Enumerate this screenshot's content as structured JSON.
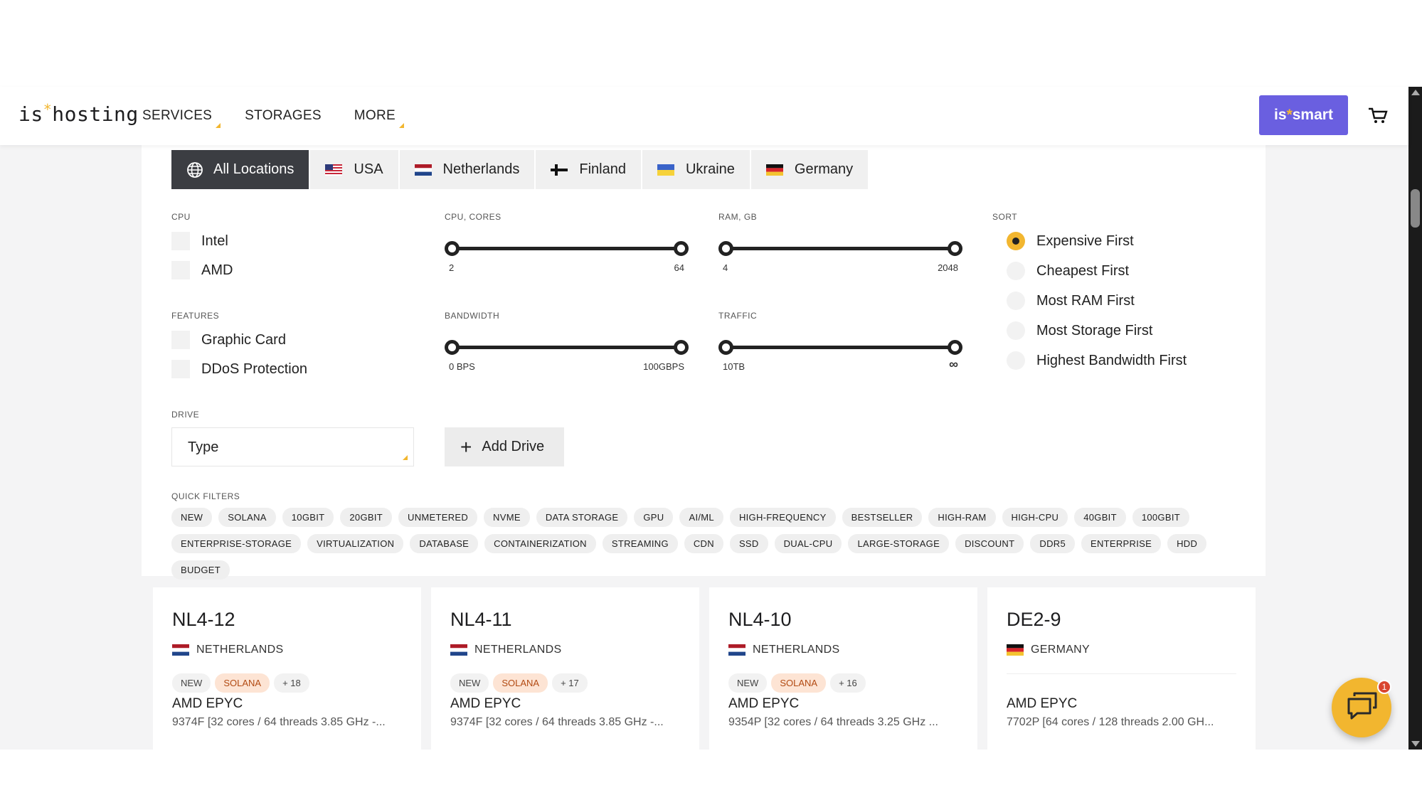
{
  "header": {
    "logo_pre": "is",
    "logo_star": "*",
    "logo_post": "hosting",
    "nav": [
      {
        "label": "SERVICES",
        "has_dropdown": true
      },
      {
        "label": "STORAGES",
        "has_dropdown": false
      },
      {
        "label": "MORE",
        "has_dropdown": true
      }
    ],
    "smart_pre": "is",
    "smart_star": "*",
    "smart_post": "smart"
  },
  "locations": [
    {
      "label": "All Locations",
      "active": true
    },
    {
      "label": "USA",
      "active": false
    },
    {
      "label": "Netherlands",
      "active": false
    },
    {
      "label": "Finland",
      "active": false
    },
    {
      "label": "Ukraine",
      "active": false
    },
    {
      "label": "Germany",
      "active": false
    }
  ],
  "filters": {
    "cpu_label": "CPU",
    "cpu_options": [
      "Intel",
      "AMD"
    ],
    "features_label": "FEATURES",
    "feature_options": [
      "Graphic Card",
      "DDoS Protection"
    ],
    "drive_label": "DRIVE",
    "drive_type": "Type",
    "add_drive": "Add Drive",
    "cpu_cores": {
      "label": "CPU, CORES",
      "min": "2",
      "max": "64"
    },
    "ram": {
      "label": "RAM, GB",
      "min": "4",
      "max": "2048"
    },
    "bandwidth": {
      "label": "BANDWIDTH",
      "min": "0 BPS",
      "max": "100GBPS"
    },
    "traffic": {
      "label": "TRAFFIC",
      "min": "10TB",
      "max": "∞"
    },
    "sort_label": "SORT",
    "sort_options": [
      {
        "label": "Expensive First",
        "selected": true
      },
      {
        "label": "Cheapest First",
        "selected": false
      },
      {
        "label": "Most RAM First",
        "selected": false
      },
      {
        "label": "Most Storage First",
        "selected": false
      },
      {
        "label": "Highest Bandwidth First",
        "selected": false
      }
    ],
    "quick_filters_label": "QUICK FILTERS",
    "quick_filters": [
      "NEW",
      "SOLANA",
      "10GBIT",
      "20GBIT",
      "UNMETERED",
      "NVME",
      "DATA STORAGE",
      "GPU",
      "AI/ML",
      "HIGH-FREQUENCY",
      "BESTSELLER",
      "HIGH-RAM",
      "HIGH-CPU",
      "40GBIT",
      "100GBIT",
      "ENTERPRISE-STORAGE",
      "VIRTUALIZATION",
      "DATABASE",
      "CONTAINERIZATION",
      "STREAMING",
      "CDN",
      "SSD",
      "DUAL-CPU",
      "LARGE-STORAGE",
      "DISCOUNT",
      "DDR5",
      "ENTERPRISE",
      "HDD",
      "BUDGET"
    ]
  },
  "cards": [
    {
      "name": "NL4-12",
      "country": "NETHERLANDS",
      "flag": "nl",
      "tags": [
        "NEW",
        "SOLANA",
        "+ 18"
      ],
      "cpu": "AMD EPYC",
      "cpu_detail": "9374F [32 cores / 64 threads 3.85 GHz -..."
    },
    {
      "name": "NL4-11",
      "country": "NETHERLANDS",
      "flag": "nl",
      "tags": [
        "NEW",
        "SOLANA",
        "+ 17"
      ],
      "cpu": "AMD EPYC",
      "cpu_detail": "9374F [32 cores / 64 threads 3.85 GHz -..."
    },
    {
      "name": "NL4-10",
      "country": "NETHERLANDS",
      "flag": "nl",
      "tags": [
        "NEW",
        "SOLANA",
        "+ 16"
      ],
      "cpu": "AMD EPYC",
      "cpu_detail": "9354P [32 cores / 64 threads 3.25 GHz ..."
    },
    {
      "name": "DE2-9",
      "country": "GERMANY",
      "flag": "de",
      "tags": [],
      "cpu": "AMD EPYC",
      "cpu_detail": "7702P [64 cores / 128 threads 2.00 GH..."
    }
  ],
  "chat": {
    "badge": "1"
  },
  "colors": {
    "accent": "#f2b62f",
    "smart": "#6a5fe0",
    "active_tab": "#3b3d42",
    "tag_orange_bg": "#fde4d4",
    "tag_orange_fg": "#b24a12"
  }
}
